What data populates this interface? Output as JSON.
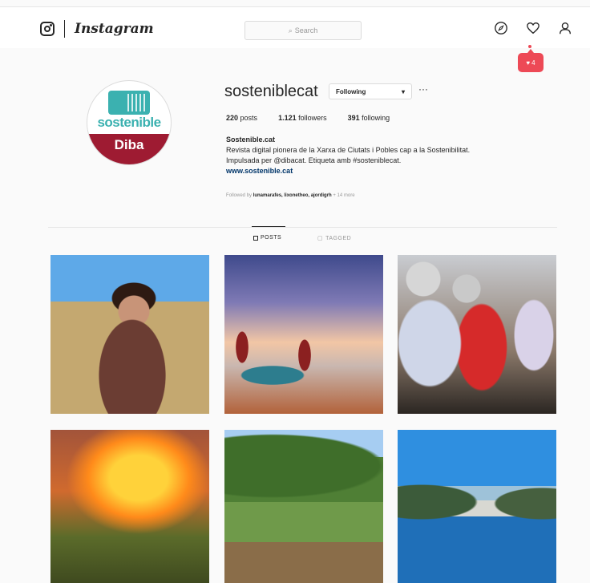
{
  "nav": {
    "wordmark": "Instagram",
    "search_placeholder": "Search",
    "icons": [
      "instagram-icon",
      "compass-icon",
      "heart-icon",
      "user-icon"
    ]
  },
  "notification": {
    "count": "4",
    "color": "#ed4956"
  },
  "profile": {
    "username": "sosteniblecat",
    "follow_label": "Following",
    "stats": {
      "posts_count": "220",
      "posts_label": "posts",
      "followers_count": "1.121",
      "followers_label": "followers",
      "following_count": "391",
      "following_label": "following"
    },
    "display_name": "Sostenible.cat",
    "bio_line1": "Revista digital pionera de la Xarxa de Ciutats i Pobles cap a la Sostenibilitat.",
    "bio_line2": "Impulsada per @dibacat. Etiqueta amb #sosteniblecat.",
    "website": "www.sostenible.cat",
    "followed_by_prefix": "Followed by",
    "followed_by_names": "lunamarafes, lixonetheo, ajordigrh",
    "followed_by_suffix": "+ 14 more",
    "avatar": {
      "brand": "sostenible",
      "sub": "Diba",
      "brand_color": "#3bb1b0",
      "sub_color": "#9e1b32"
    }
  },
  "tabs": [
    {
      "label": "POSTS",
      "active": true
    },
    {
      "label": "TAGGED",
      "active": false
    }
  ],
  "grid": [
    {
      "subject": "woman sitting in a harvested wheat field"
    },
    {
      "subject": "fishermen with a boat on the beach at sunrise"
    },
    {
      "subject": "group of cyclists racing"
    },
    {
      "subject": "forest fire with firefighters"
    },
    {
      "subject": "hillside meadow with grazing animals"
    },
    {
      "subject": "coastal bay with boats and white village"
    }
  ]
}
